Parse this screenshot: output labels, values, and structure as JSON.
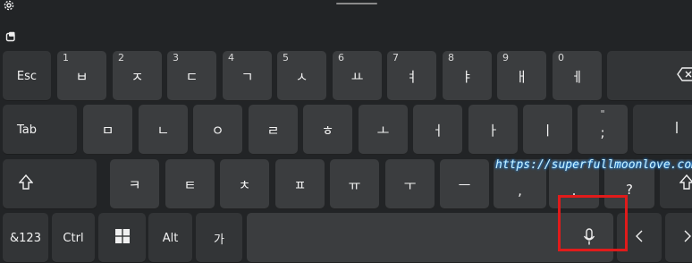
{
  "icons": {
    "settings": "gear-icon",
    "clipboard": "clipboard-icon",
    "shift": "shift-arrow-icon",
    "backspace": "backspace-icon",
    "windows": "windows-logo-icon",
    "mic": "microphone-icon",
    "left": "chevron-left-icon",
    "right": "chevron-right-icon"
  },
  "row1": {
    "esc": "Esc",
    "keys": [
      {
        "num": "1",
        "char": "ㅂ"
      },
      {
        "num": "2",
        "char": "ㅈ"
      },
      {
        "num": "3",
        "char": "ㄷ"
      },
      {
        "num": "4",
        "char": "ㄱ"
      },
      {
        "num": "5",
        "char": "ㅅ"
      },
      {
        "num": "6",
        "char": "ㅛ"
      },
      {
        "num": "7",
        "char": "ㅕ"
      },
      {
        "num": "8",
        "char": "ㅑ"
      },
      {
        "num": "9",
        "char": "ㅐ"
      },
      {
        "num": "0",
        "char": "ㅔ"
      }
    ]
  },
  "row2": {
    "tab": "Tab",
    "keys": [
      "ㅁ",
      "ㄴ",
      "ㅇ",
      "ㄹ",
      "ㅎ",
      "ㅗ",
      "ㅓ",
      "ㅏ",
      "ㅣ"
    ],
    "colon_key": {
      "top": "\"",
      "bottom": ";"
    }
  },
  "row3": {
    "keys": [
      "ㅋ",
      "ㅌ",
      "ㅊ",
      "ㅍ",
      "ㅠ",
      "ㅜ",
      "ㅡ"
    ],
    "comma_key": ",",
    "period_key": ".",
    "question_key": "?"
  },
  "row4": {
    "num_sym": "&123",
    "ctrl": "Ctrl",
    "alt": "Alt",
    "lang": "가"
  },
  "watermark": "https://superfullmoonlove.com/",
  "colors": {
    "background": "#222426",
    "key": "#3b3d3f",
    "highlight": "#e01b1b",
    "watermark_glow": "#1e90ff"
  }
}
